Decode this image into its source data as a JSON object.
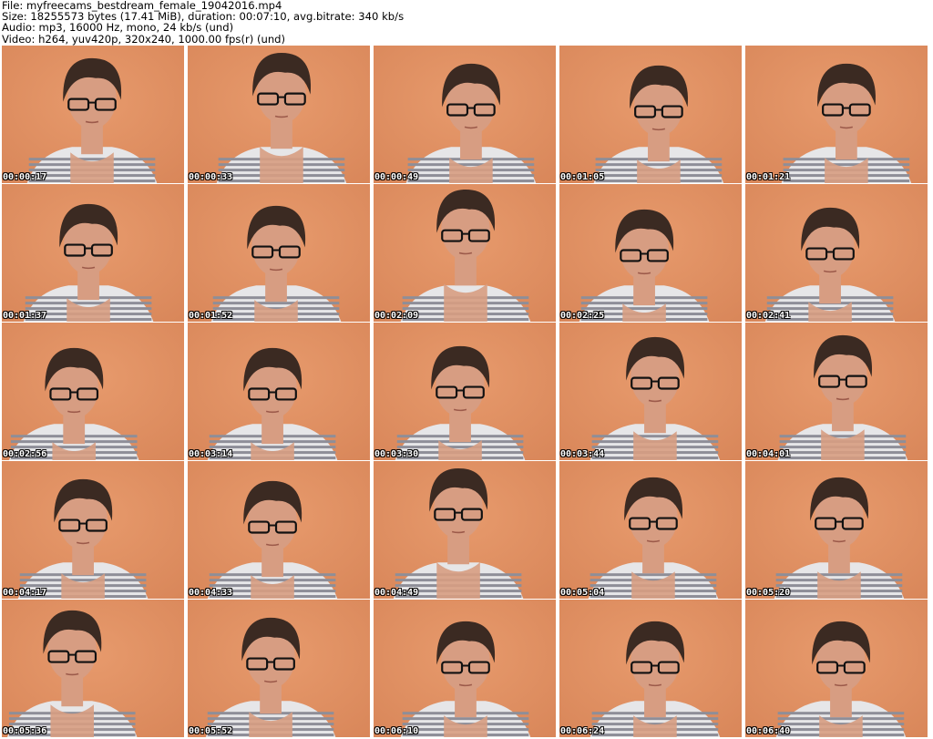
{
  "header": {
    "file_line": "File: myfreecams_bestdream_female_19042016.mp4",
    "size_line": "Size: 18255573 bytes (17.41 MiB), duration: 00:07:10, avg.bitrate: 340 kb/s",
    "audio_line": "Audio: mp3, 16000 Hz, mono, 24 kb/s (und)",
    "video_line": "Video: h264, yuv420p, 320x240, 1000.00 fps(r) (und)"
  },
  "colors": {
    "background_wall": "#d9875a",
    "skin": "#d79d82",
    "hair": "#3b2a22",
    "shirt_stripe_light": "#e6e6e8",
    "shirt_stripe_dark": "#8e8e98",
    "glasses": "#111111"
  },
  "thumbnails": [
    {
      "timestamp": "00:00:17"
    },
    {
      "timestamp": "00:00:33"
    },
    {
      "timestamp": "00:00:49"
    },
    {
      "timestamp": "00:01:05"
    },
    {
      "timestamp": "00:01:21"
    },
    {
      "timestamp": "00:01:37"
    },
    {
      "timestamp": "00:01:52"
    },
    {
      "timestamp": "00:02:09"
    },
    {
      "timestamp": "00:02:25"
    },
    {
      "timestamp": "00:02:41"
    },
    {
      "timestamp": "00:02:56"
    },
    {
      "timestamp": "00:03:14"
    },
    {
      "timestamp": "00:03:30"
    },
    {
      "timestamp": "00:03:44"
    },
    {
      "timestamp": "00:04:01"
    },
    {
      "timestamp": "00:04:17"
    },
    {
      "timestamp": "00:04:33"
    },
    {
      "timestamp": "00:04:49"
    },
    {
      "timestamp": "00:05:04"
    },
    {
      "timestamp": "00:05:20"
    },
    {
      "timestamp": "00:05:36"
    },
    {
      "timestamp": "00:05:52"
    },
    {
      "timestamp": "00:06:10"
    },
    {
      "timestamp": "00:06:24"
    },
    {
      "timestamp": "00:06:40"
    }
  ]
}
